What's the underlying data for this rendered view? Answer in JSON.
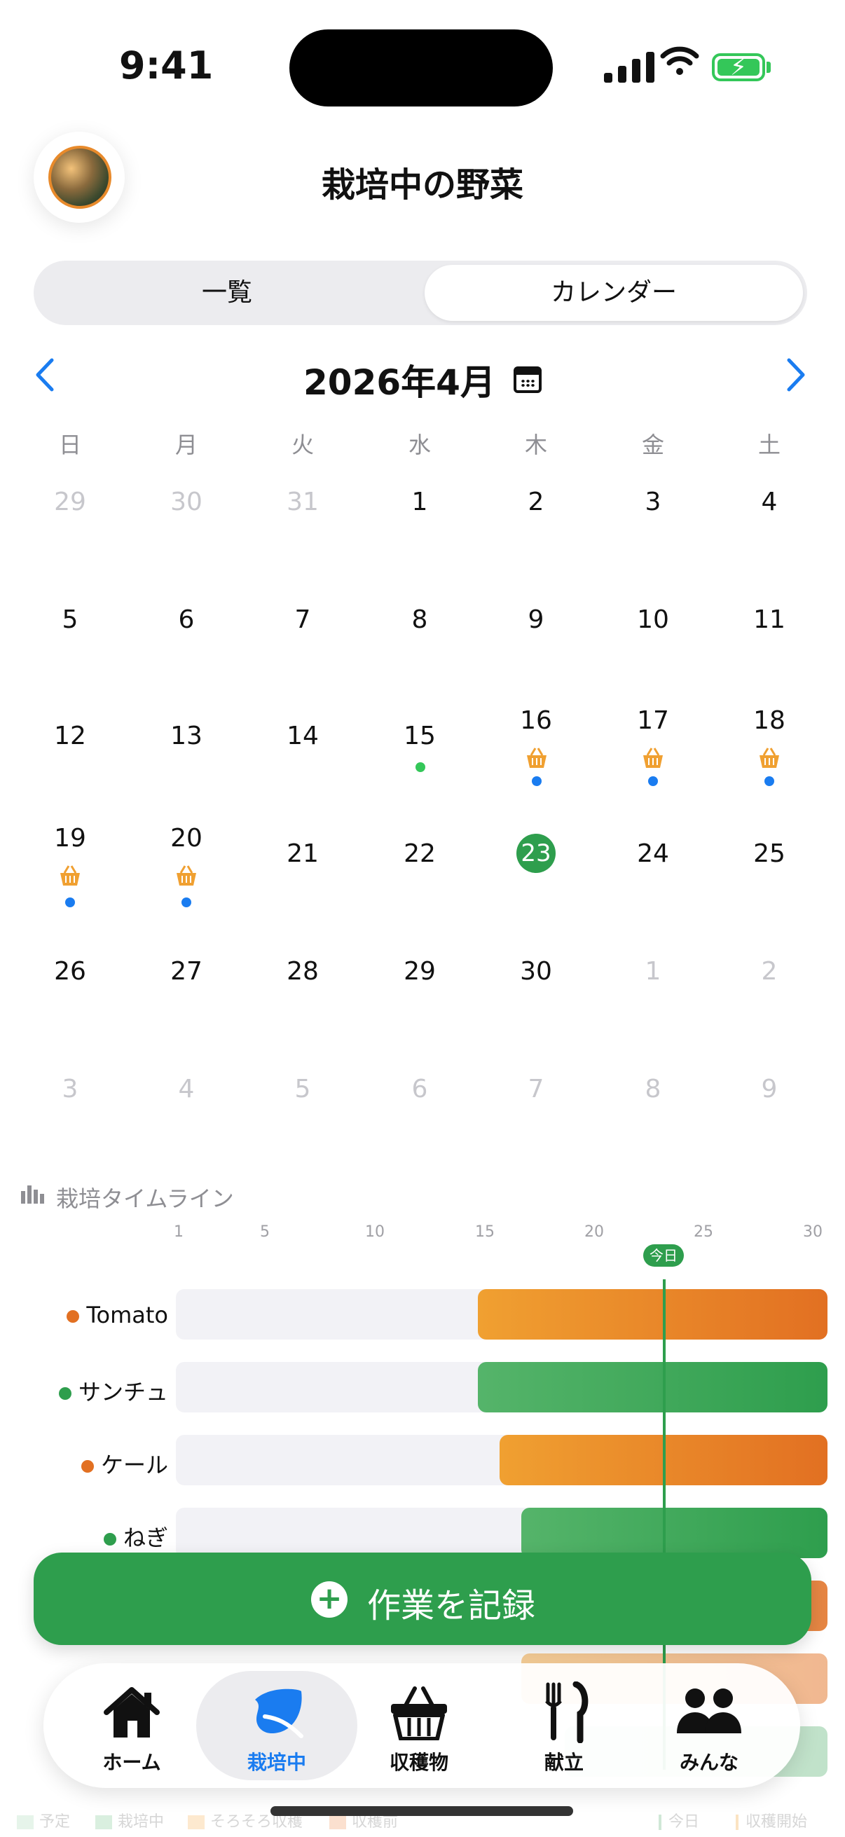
{
  "status": {
    "time": "9:41"
  },
  "header": {
    "title": "栽培中の野菜"
  },
  "segment": {
    "list": "一覧",
    "calendar": "カレンダー"
  },
  "calendar": {
    "month": "2026年4月",
    "weekdays": [
      "日",
      "月",
      "火",
      "水",
      "木",
      "金",
      "土"
    ],
    "weeks": [
      [
        "29",
        "30",
        "31",
        "1",
        "2",
        "3",
        "4"
      ],
      [
        "5",
        "6",
        "7",
        "8",
        "9",
        "10",
        "11"
      ],
      [
        "12",
        "13",
        "14",
        "15",
        "16",
        "17",
        "18"
      ],
      [
        "19",
        "20",
        "21",
        "22",
        "23",
        "24",
        "25"
      ],
      [
        "26",
        "27",
        "28",
        "29",
        "30",
        "1",
        "2"
      ],
      [
        "3",
        "4",
        "5",
        "6",
        "7",
        "8",
        "9"
      ]
    ],
    "today": "23"
  },
  "timeline": {
    "title": "栽培タイムライン",
    "axis": [
      "1",
      "5",
      "10",
      "15",
      "20",
      "25",
      "30"
    ],
    "today_label": "今日",
    "rows": [
      {
        "name": "Tomato",
        "color": "#e27022"
      },
      {
        "name": "サンチュ",
        "color": "#2e9e4d"
      },
      {
        "name": "ケール",
        "color": "#e27022"
      },
      {
        "name": "ねぎ",
        "color": "#2e9e4d"
      }
    ]
  },
  "cta": {
    "label": "作業を記録"
  },
  "tabs": [
    {
      "label": "ホーム",
      "icon": "home-icon"
    },
    {
      "label": "栽培中",
      "icon": "leaf-icon"
    },
    {
      "label": "収穫物",
      "icon": "basket-icon"
    },
    {
      "label": "献立",
      "icon": "fork-knife-icon"
    },
    {
      "label": "みんな",
      "icon": "people-icon"
    }
  ],
  "legend": [
    "予定",
    "栽培中",
    "そろそろ収穫",
    "収穫前",
    "今日",
    "収穫開始"
  ],
  "colors": {
    "accent": "#2e9e4d",
    "blue": "#1a7cf0",
    "orange": "#e27022"
  }
}
